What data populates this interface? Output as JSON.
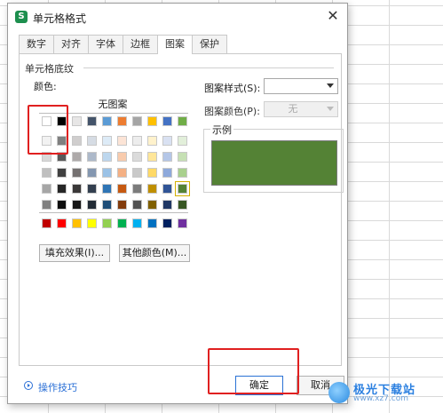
{
  "dialog": {
    "title": "单元格格式",
    "app_icon": "S",
    "close_glyph": "✕"
  },
  "tabs": [
    {
      "label": "数字",
      "active": false
    },
    {
      "label": "对齐",
      "active": false
    },
    {
      "label": "字体",
      "active": false
    },
    {
      "label": "边框",
      "active": false
    },
    {
      "label": "图案",
      "active": true
    },
    {
      "label": "保护",
      "active": false
    }
  ],
  "shading": {
    "section_title": "单元格底纹",
    "color_label": "颜色:",
    "no_pattern": "无图案",
    "palette_rows": [
      [
        "#ffffff",
        "#000000",
        "#e7e6e6",
        "#44546a",
        "#5b9bd5",
        "#ed7d31",
        "#a5a5a5",
        "#ffc000",
        "#4472c4",
        "#70ad47"
      ],
      [
        "#f2f2f2",
        "#7f7f7f",
        "#d0cece",
        "#d6dce4",
        "#ddebf7",
        "#fce4d6",
        "#ededed",
        "#fff2cc",
        "#d9e1f2",
        "#e2efda"
      ],
      [
        "#d9d9d9",
        "#595959",
        "#aeaaaa",
        "#adb9ca",
        "#bdd7ee",
        "#f8cbad",
        "#dbdbdb",
        "#ffe699",
        "#b4c6e7",
        "#c6e0b4"
      ],
      [
        "#bfbfbf",
        "#404040",
        "#757171",
        "#8497b0",
        "#9bc2e6",
        "#f4b084",
        "#c9c9c9",
        "#ffd966",
        "#8ea9db",
        "#a9d08e"
      ],
      [
        "#a6a6a6",
        "#262626",
        "#3a3838",
        "#333f4f",
        "#2f75b5",
        "#c65911",
        "#7b7b7b",
        "#bf8f00",
        "#305496",
        "#548235"
      ],
      [
        "#808080",
        "#0d0d0d",
        "#161616",
        "#222b35",
        "#1f4e78",
        "#833c0c",
        "#525252",
        "#806000",
        "#203764",
        "#375623"
      ]
    ],
    "standard_colors": [
      "#c00000",
      "#ff0000",
      "#ffc000",
      "#ffff00",
      "#92d050",
      "#00b050",
      "#00b0f0",
      "#0070c0",
      "#002060",
      "#7030a0"
    ],
    "fill_effects_button": "填充效果(I)...",
    "more_colors_button": "其他颜色(M)...",
    "selected_color": "#548235"
  },
  "pattern": {
    "style_label": "图案样式(S):",
    "style_value": "",
    "color_label": "图案颜色(P):",
    "color_value": "无",
    "sample_label": "示例",
    "sample_color": "#548235"
  },
  "footer": {
    "tips_label": "操作技巧",
    "ok_label": "确定",
    "cancel_label": "取消"
  },
  "watermark": {
    "name": "极光下载站",
    "url": "www.xz7.com"
  },
  "colors": {
    "accent": "#2a72d5",
    "highlight": "#e02020"
  }
}
